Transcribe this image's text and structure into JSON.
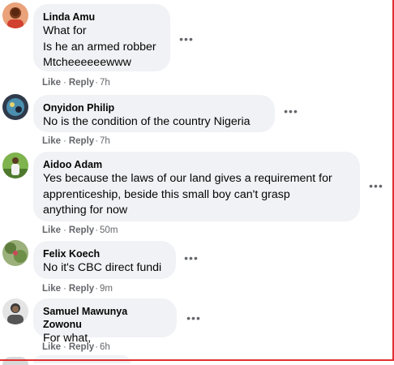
{
  "comments": [
    {
      "author": "Linda Amu",
      "text": "What for\nIs he an armed robber\nMtcheeeeeewww",
      "like": "Like",
      "reply": "Reply",
      "time": "7h",
      "avatar_color": "#c0392b"
    },
    {
      "author": "Onyidon Philip",
      "text": "No is the condition of the country Nigeria",
      "like": "Like",
      "reply": "Reply",
      "time": "7h",
      "avatar_color": "#2c3e50"
    },
    {
      "author": "Aidoo Adam",
      "text": "Yes because the laws of our land gives a requirement for\napprenticeship, beside this small boy can't grasp\nanything for now",
      "like": "Like",
      "reply": "Reply",
      "time": "50m",
      "avatar_color": "#5a8f3a"
    },
    {
      "author": "Felix Koech",
      "text": "No it's CBC direct fundi",
      "like": "Like",
      "reply": "Reply",
      "time": "9m",
      "avatar_color": "#6b8e5a"
    },
    {
      "author": "Samuel Mawunya Zowonu",
      "text": "For what,",
      "like": "Like",
      "reply": "Reply",
      "time": "6h",
      "avatar_color": "#7f7f7f"
    }
  ],
  "more_icon": "more-horizontal-icon",
  "separator": "·",
  "colors": {
    "bubble": "#f0f2f5",
    "meta": "#65676b",
    "text": "#050505",
    "border": "#e03030"
  }
}
